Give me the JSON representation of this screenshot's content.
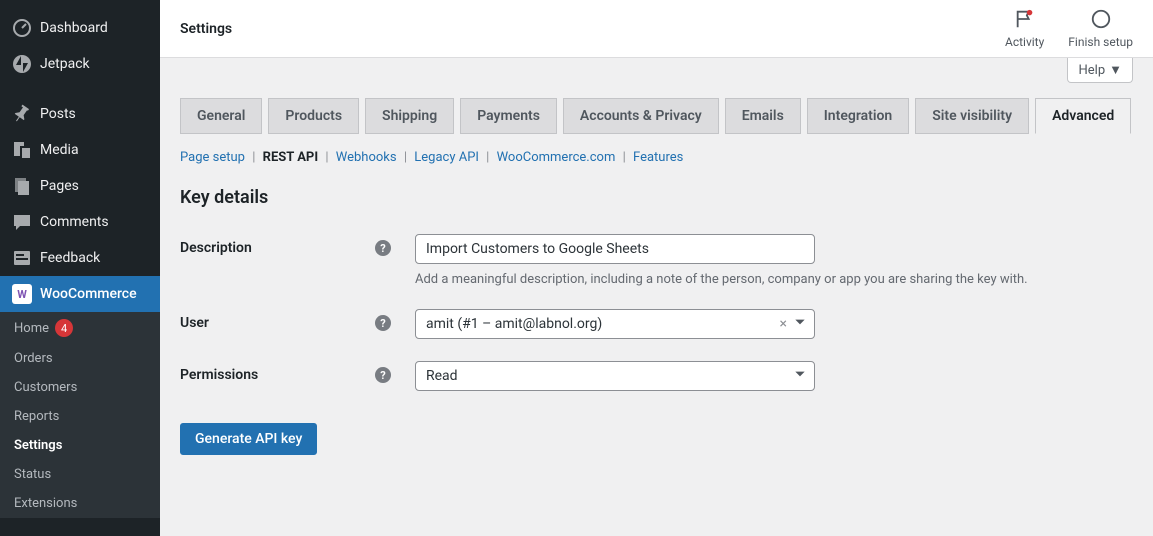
{
  "sidebar": {
    "items": [
      {
        "label": "Dashboard"
      },
      {
        "label": "Jetpack"
      },
      {
        "label": "Posts"
      },
      {
        "label": "Media"
      },
      {
        "label": "Pages"
      },
      {
        "label": "Comments"
      },
      {
        "label": "Feedback"
      },
      {
        "label": "WooCommerce"
      }
    ],
    "submenu": [
      {
        "label": "Home",
        "badge": "4"
      },
      {
        "label": "Orders"
      },
      {
        "label": "Customers"
      },
      {
        "label": "Reports"
      },
      {
        "label": "Settings"
      },
      {
        "label": "Status"
      },
      {
        "label": "Extensions"
      }
    ]
  },
  "header": {
    "title": "Settings",
    "activity_label": "Activity",
    "finish_label": "Finish setup"
  },
  "help_btn": "Help",
  "tabs": [
    "General",
    "Products",
    "Shipping",
    "Payments",
    "Accounts & Privacy",
    "Emails",
    "Integration",
    "Site visibility",
    "Advanced"
  ],
  "subtabs": [
    "Page setup",
    "REST API",
    "Webhooks",
    "Legacy API",
    "WooCommerce.com",
    "Features"
  ],
  "section_title": "Key details",
  "fields": {
    "description": {
      "label": "Description",
      "value": "Import Customers to Google Sheets",
      "help": "Add a meaningful description, including a note of the person, company or app you are sharing the key with."
    },
    "user": {
      "label": "User",
      "value": "amit (#1 – amit@labnol.org)"
    },
    "permissions": {
      "label": "Permissions",
      "value": "Read"
    }
  },
  "generate_btn": "Generate API key"
}
